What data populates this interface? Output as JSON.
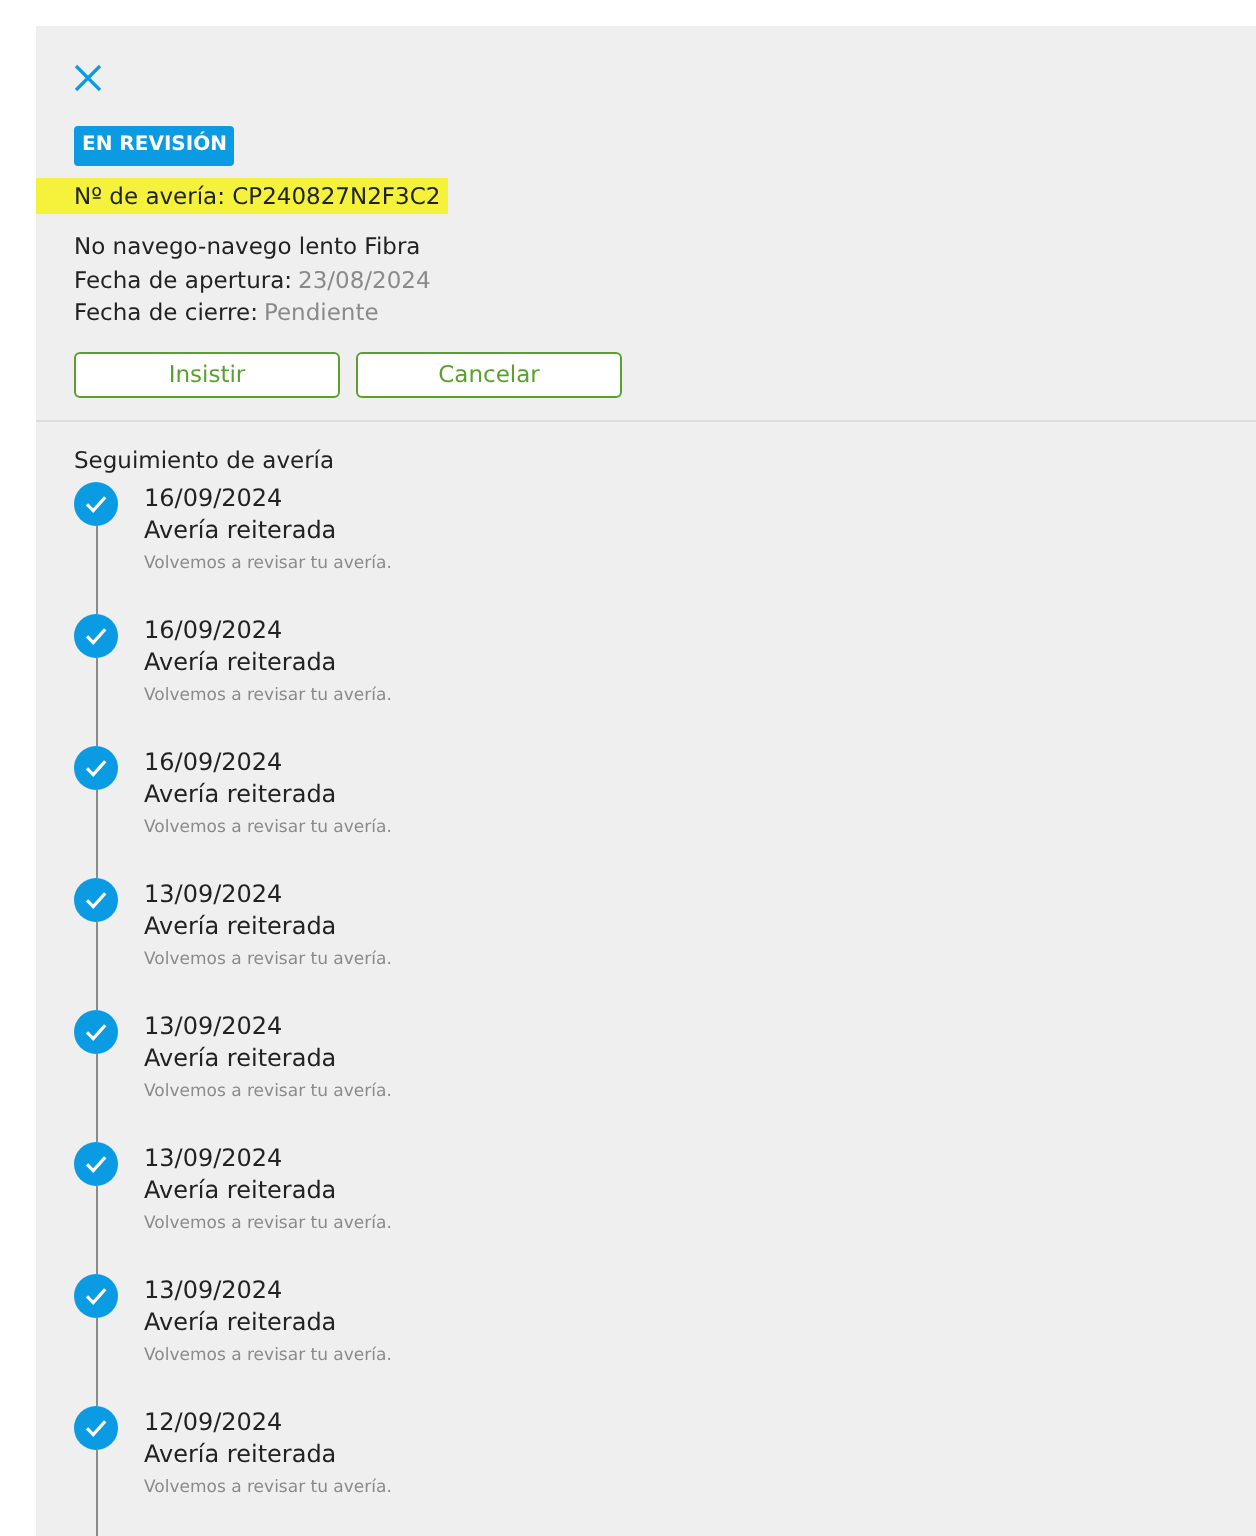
{
  "status_badge": "EN REVISIÓN",
  "ticket": {
    "label": "Nº de avería:",
    "number": "CP240827N2F3C2",
    "highlighted": true
  },
  "details": {
    "title": "No navego-navego lento Fibra",
    "fields": [
      {
        "label": "Fecha de apertura:",
        "value": "23/08/2024"
      },
      {
        "label": "Fecha de cierre:",
        "value": "Pendiente"
      }
    ]
  },
  "buttons": [
    "Insistir",
    "Cancelar"
  ],
  "tracking": {
    "title": "Seguimiento de avería",
    "events": [
      {
        "date": "16/09/2024",
        "title": "Avería reiterada",
        "description": "Volvemos a revisar tu avería.",
        "done": true
      },
      {
        "date": "16/09/2024",
        "title": "Avería reiterada",
        "description": "Volvemos a revisar tu avería.",
        "done": true
      },
      {
        "date": "16/09/2024",
        "title": "Avería reiterada",
        "description": "Volvemos a revisar tu avería.",
        "done": true
      },
      {
        "date": "13/09/2024",
        "title": "Avería reiterada",
        "description": "Volvemos a revisar tu avería.",
        "done": true
      },
      {
        "date": "13/09/2024",
        "title": "Avería reiterada",
        "description": "Volvemos a revisar tu avería.",
        "done": true
      },
      {
        "date": "13/09/2024",
        "title": "Avería reiterada",
        "description": "Volvemos a revisar tu avería.",
        "done": true
      },
      {
        "date": "13/09/2024",
        "title": "Avería reiterada",
        "description": "Volvemos a revisar tu avería.",
        "done": true
      },
      {
        "date": "12/09/2024",
        "title": "Avería reiterada",
        "description": "Volvemos a revisar tu avería.",
        "done": true
      }
    ]
  }
}
